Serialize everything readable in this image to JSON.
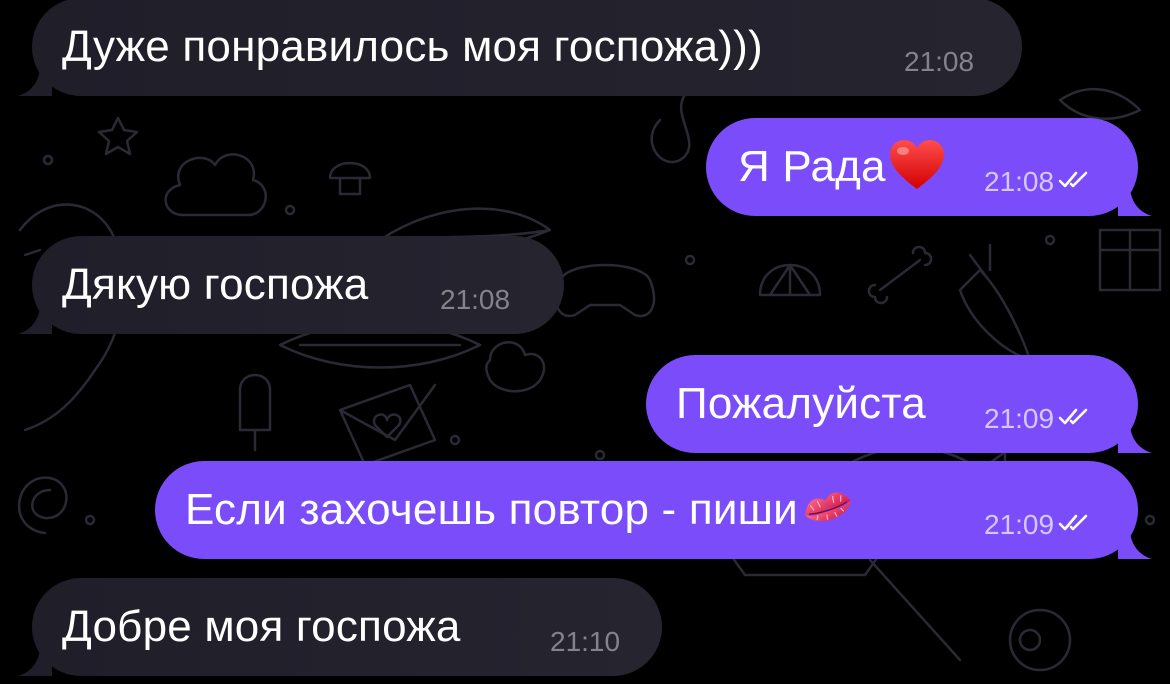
{
  "chat": {
    "messages": [
      {
        "direction": "incoming",
        "text": "Дуже понравилось моя госпожа)))",
        "time": "21:08"
      },
      {
        "direction": "outgoing",
        "text": "Я Рада",
        "emoji": "heart-emoji",
        "time": "21:08",
        "status": "read"
      },
      {
        "direction": "incoming",
        "text": "Дякую госпожа",
        "time": "21:08"
      },
      {
        "direction": "outgoing",
        "text": "Пожалуйста",
        "time": "21:09",
        "status": "read"
      },
      {
        "direction": "outgoing",
        "text": "Если захочешь повтор - пиши",
        "emoji": "kiss-mark-emoji",
        "time": "21:09",
        "status": "read"
      },
      {
        "direction": "incoming",
        "text": "Добре моя госпожа",
        "time": "21:10"
      }
    ]
  },
  "colors": {
    "background": "#000000",
    "incoming_bubble": "#1f1e29",
    "outgoing_bubble": "#7b4dfa",
    "text": "#ffffff",
    "incoming_time": "#84838c",
    "outgoing_time": "#d4c8ff",
    "doodle_lines": "#2a2a35"
  }
}
